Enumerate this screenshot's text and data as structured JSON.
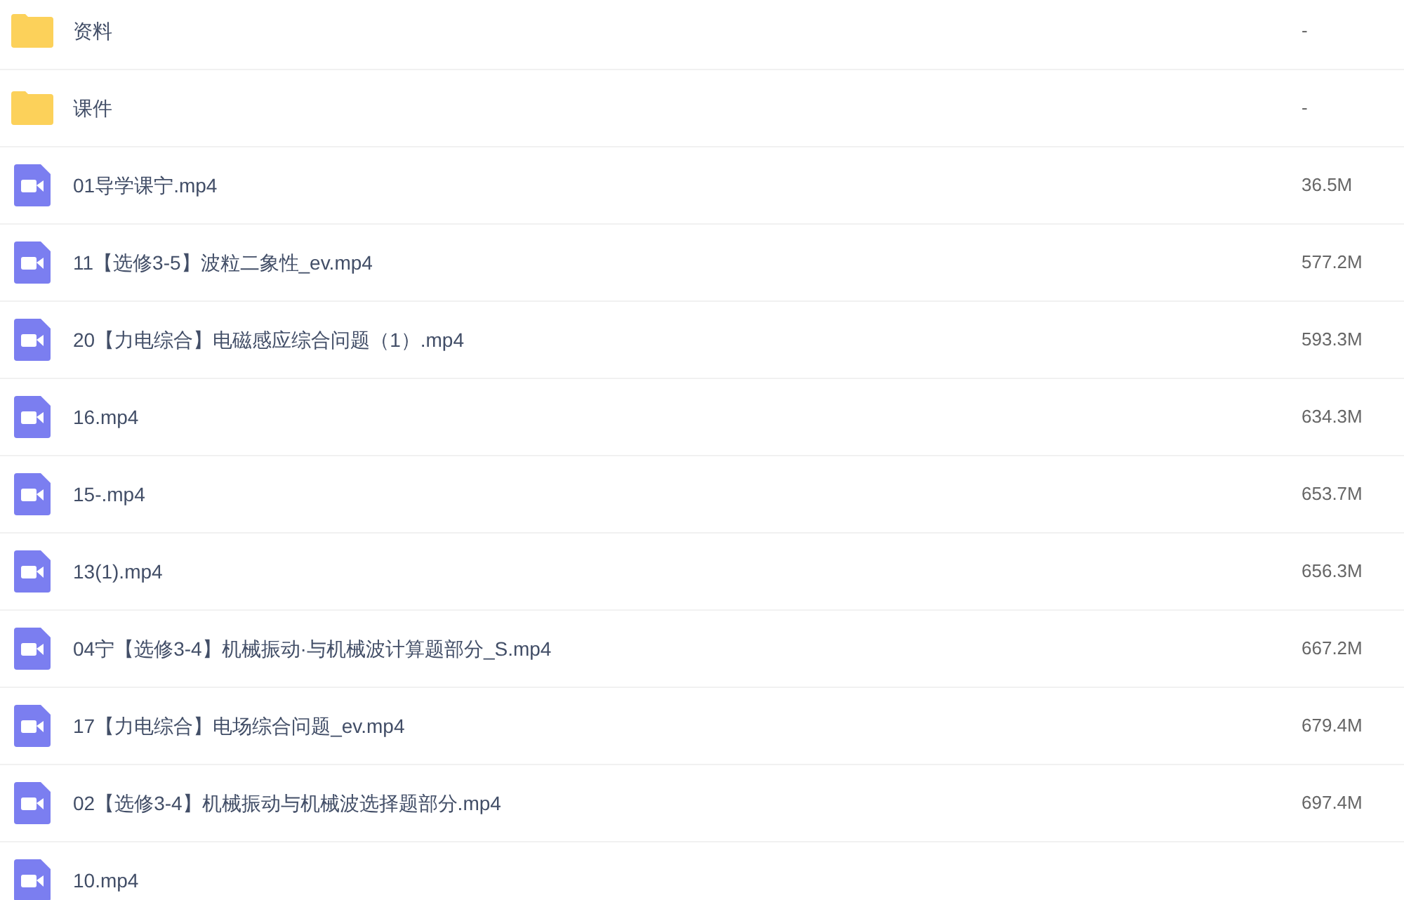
{
  "files": [
    {
      "kind": "folder",
      "name": "资料",
      "size": "-"
    },
    {
      "kind": "folder",
      "name": "课件",
      "size": "-"
    },
    {
      "kind": "video",
      "name": "01导学课宁.mp4",
      "size": "36.5M"
    },
    {
      "kind": "video",
      "name": "11【选修3-5】波粒二象性_ev.mp4",
      "size": "577.2M"
    },
    {
      "kind": "video",
      "name": "20【力电综合】电磁感应综合问题（1）.mp4",
      "size": "593.3M"
    },
    {
      "kind": "video",
      "name": "16.mp4",
      "size": "634.3M"
    },
    {
      "kind": "video",
      "name": "15-.mp4",
      "size": "653.7M"
    },
    {
      "kind": "video",
      "name": "13(1).mp4",
      "size": "656.3M"
    },
    {
      "kind": "video",
      "name": "04宁【选修3-4】机械振动·与机械波计算题部分_S.mp4",
      "size": "667.2M"
    },
    {
      "kind": "video",
      "name": "17【力电综合】电场综合问题_ev.mp4",
      "size": "679.4M"
    },
    {
      "kind": "video",
      "name": "02【选修3-4】机械振动与机械波选择题部分.mp4",
      "size": "697.4M"
    },
    {
      "kind": "video",
      "name": "10.mp4"
    }
  ]
}
